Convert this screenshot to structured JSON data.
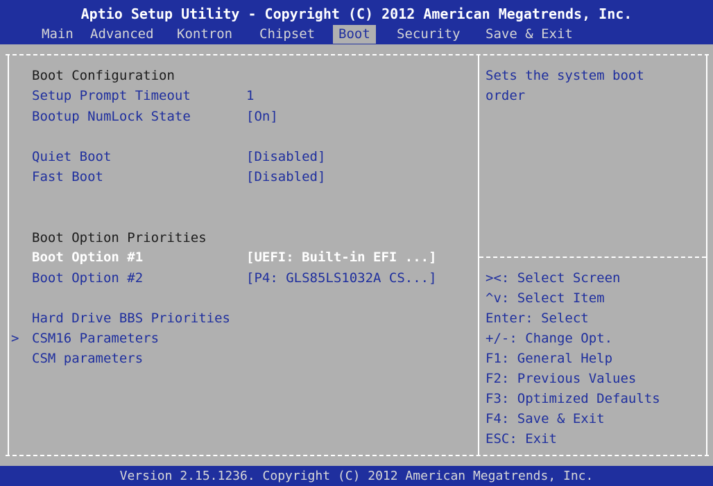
{
  "header": {
    "title": "Aptio Setup Utility - Copyright (C) 2012 American Megatrends, Inc.",
    "tabs": [
      {
        "label": "Main"
      },
      {
        "label": "Advanced"
      },
      {
        "label": "Kontron"
      },
      {
        "label": "Chipset"
      },
      {
        "label": "Boot"
      },
      {
        "label": "Security"
      },
      {
        "label": "Save & Exit"
      }
    ],
    "active_tab": "Boot"
  },
  "main": {
    "boot_config_header": "Boot Configuration",
    "setup_prompt_timeout": {
      "label": "Setup Prompt Timeout",
      "value": "1"
    },
    "bootup_numlock_state": {
      "label": "Bootup NumLock State",
      "value": "[On]"
    },
    "quiet_boot": {
      "label": "Quiet Boot",
      "value": "[Disabled]"
    },
    "fast_boot": {
      "label": "Fast Boot",
      "value": "[Disabled]"
    },
    "boot_option_priorities_header": "Boot Option Priorities",
    "boot_option_1": {
      "label": "Boot Option #1",
      "value": "[UEFI: Built-in EFI ...]"
    },
    "boot_option_2": {
      "label": "Boot Option #2",
      "value": "[P4: GLS85LS1032A CS...]"
    },
    "hard_drive_bbs": {
      "label": "Hard Drive BBS Priorities"
    },
    "csm16_parameters": {
      "label": "CSM16 Parameters",
      "marker": ">"
    },
    "csm_parameters": {
      "label": "CSM parameters"
    }
  },
  "help": {
    "description": [
      "Sets the system boot",
      "order"
    ],
    "keys": [
      "><: Select Screen",
      "^v: Select Item",
      "Enter: Select",
      "+/-: Change Opt.",
      "F1: General Help",
      "F2: Previous Values",
      "F3: Optimized Defaults",
      "F4: Save & Exit",
      "ESC: Exit"
    ]
  },
  "footer": {
    "version": "Version 2.15.1236. Copyright (C) 2012 American Megatrends, Inc."
  },
  "colors": {
    "bar_background": "#1f2f9e",
    "screen_background": "#b0b0b0",
    "item_text": "#1f2f9e",
    "selected_text": "#ffffff",
    "header_text": "#1c1c1c"
  }
}
